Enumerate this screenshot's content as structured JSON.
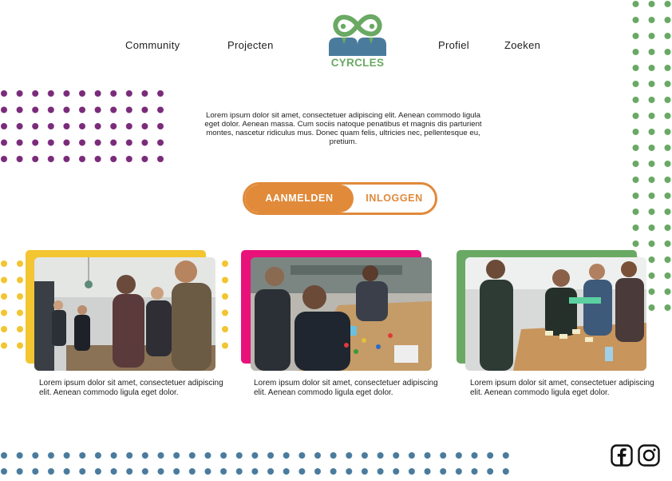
{
  "nav": {
    "community": "Community",
    "projects": "Projecten",
    "profile": "Profiel",
    "search": "Zoeken"
  },
  "logo": {
    "text": "CYRCLES"
  },
  "intro": {
    "text": "Lorem ipsum dolor sit amet, consectetuer adipiscing elit. Aenean commodo ligula eget dolor. Aenean massa. Cum sociis natoque penatibus et magnis dis parturient montes, nascetur ridiculus mus. Donec quam felis, ultricies nec, pellentesque eu, pretium."
  },
  "auth": {
    "signup_label": "AANMELDEN",
    "login_label": "INLOGGEN"
  },
  "cards": [
    {
      "caption": "Lorem ipsum dolor sit amet, consectetuer adipiscing elit. Aenean commodo ligula eget dolor.",
      "accent": "#f2c531"
    },
    {
      "caption": "Lorem ipsum dolor sit amet, consectetuer adipiscing elit. Aenean commodo ligula eget dolor.",
      "accent": "#e8127a"
    },
    {
      "caption": "Lorem ipsum dolor sit amet, consectetuer adipiscing elit. Aenean commodo ligula eget dolor.",
      "accent": "#6aa964"
    }
  ],
  "social": {
    "facebook": "facebook-icon",
    "instagram": "instagram-icon"
  },
  "colors": {
    "orange": "#e08a3a",
    "green": "#6aa964",
    "blue": "#4a7b9d",
    "purple": "#7a2b7a",
    "yellow": "#f2c531",
    "pink": "#e8127a"
  }
}
